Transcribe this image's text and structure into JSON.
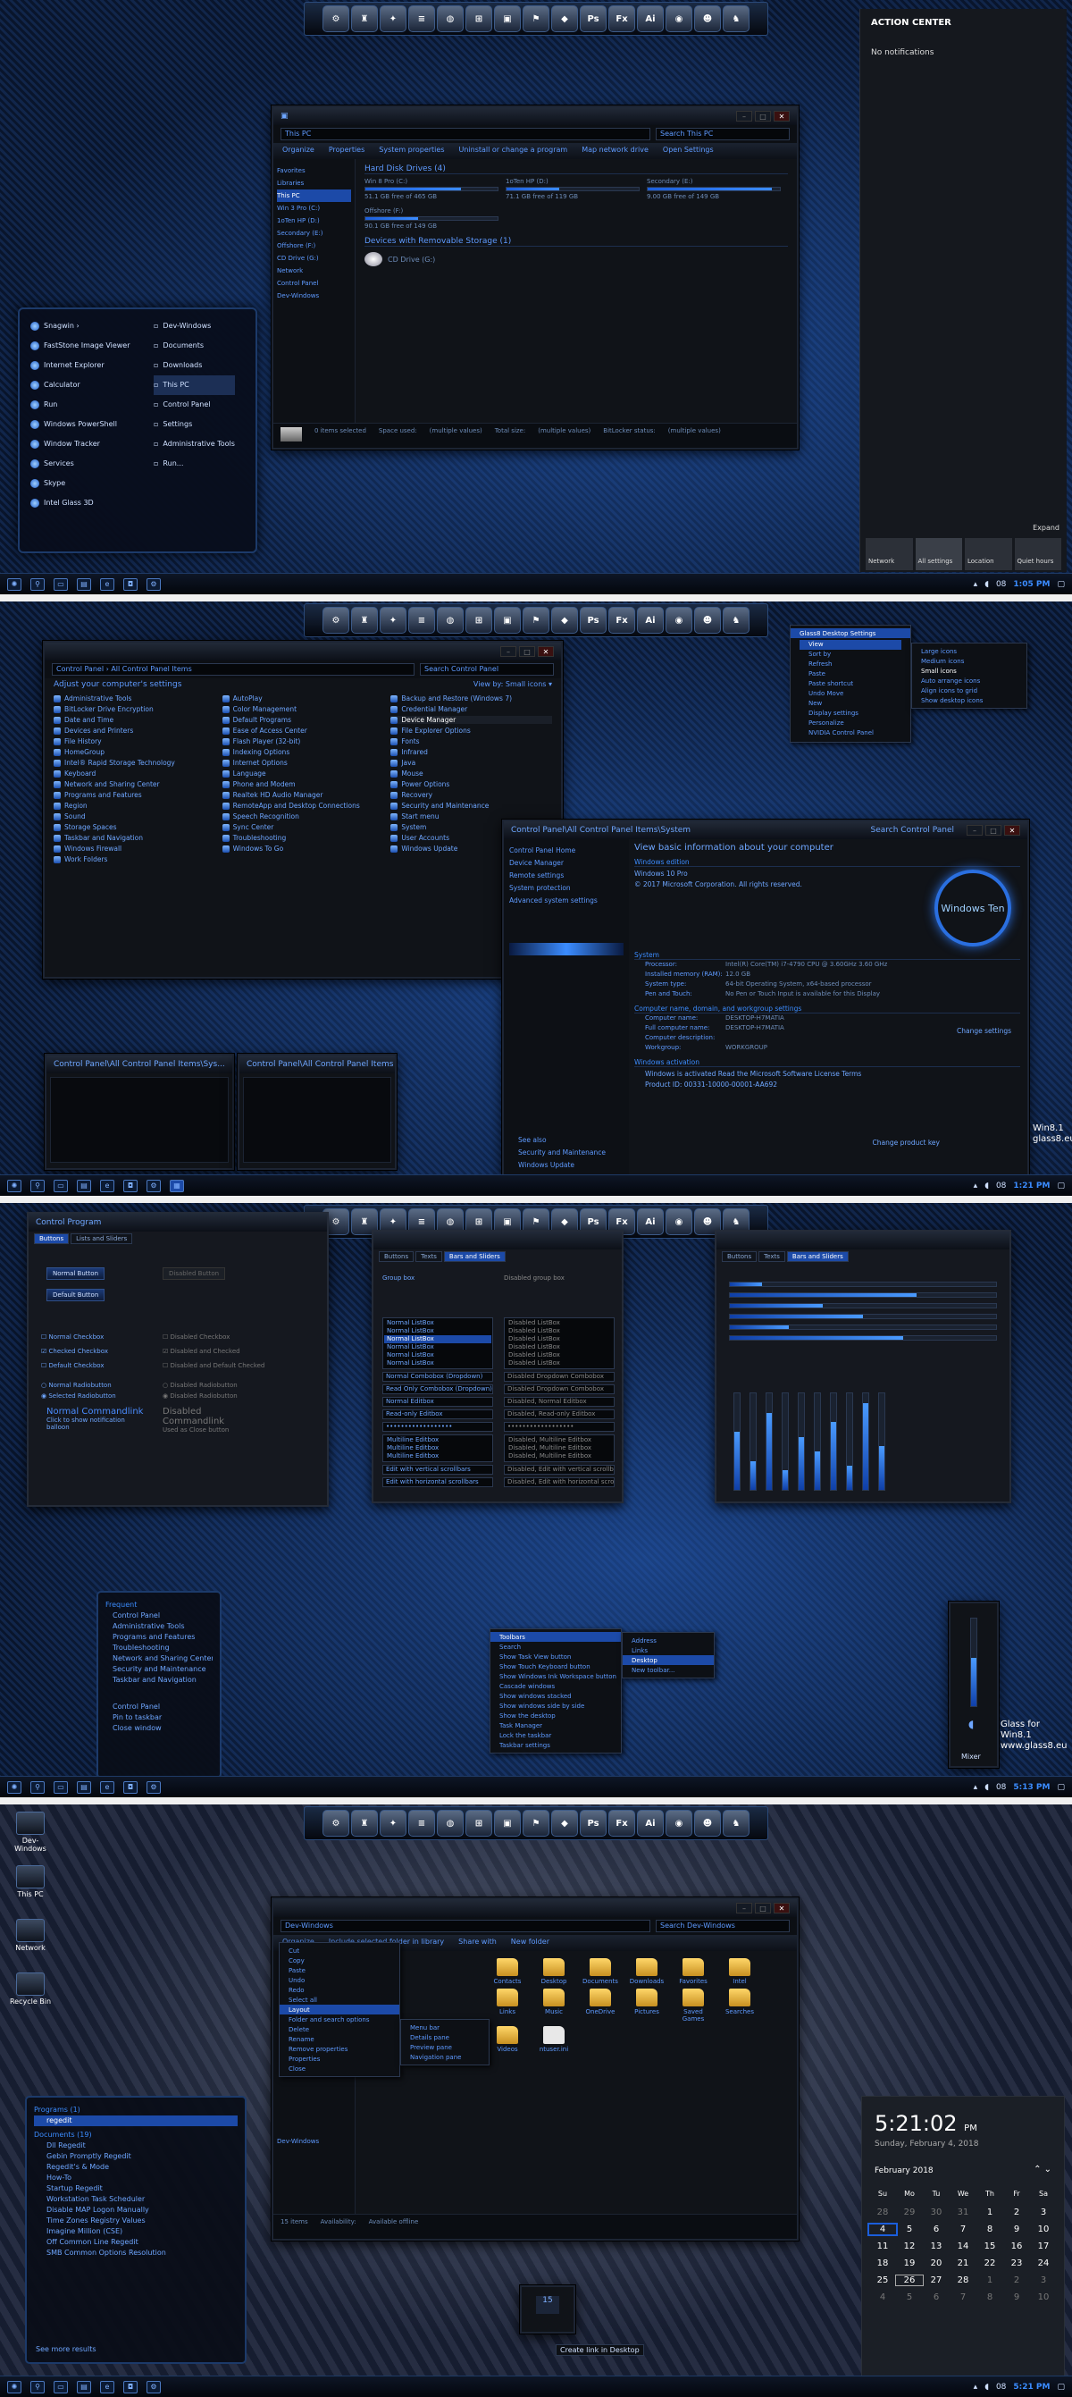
{
  "dock": {
    "icons": [
      "⚙",
      "♜",
      "✦",
      "≡",
      "◍",
      "⊞",
      "▣",
      "⚑",
      "◆",
      "Ps",
      "Fx",
      "Ai",
      "◉",
      "☻",
      "♞"
    ]
  },
  "panel1": {
    "explorer": {
      "address": "This PC",
      "search": "Search This PC",
      "commands": [
        "Organize",
        "Properties",
        "System properties",
        "Uninstall or change a program",
        "Map network drive",
        "Open Settings"
      ],
      "nav": [
        "Favorites",
        "Libraries",
        "This PC",
        "Win 3 Pro (C:)",
        "1oTen HP (D:)",
        "Secondary (E:)",
        "Offshore (F:)",
        "CD Drive (G:)",
        "Network",
        "Control Panel",
        "Dev-Windows"
      ],
      "group1": "Hard Disk Drives (4)",
      "drives": [
        {
          "name": "Win 8 Pro (C:)",
          "free": "51.1 GB free of 465 GB",
          "pct": 0.72
        },
        {
          "name": "1oTen HP (D:)",
          "free": "71.1 GB free of 119 GB",
          "pct": 0.4
        },
        {
          "name": "Secondary (E:)",
          "free": "9.00 GB free of 149 GB",
          "pct": 0.94
        },
        {
          "name": "Offshore (F:)",
          "free": "90.1 GB free of 149 GB",
          "pct": 0.4
        }
      ],
      "group2": "Devices with Removable Storage (1)",
      "removable": "CD Drive (G:)",
      "status": [
        "0 items selected",
        "Space used:",
        "(multiple values)",
        "Total size:",
        "(multiple values)",
        "BitLocker status:",
        "(multiple values)"
      ],
      "status2": [
        "Space free:",
        "(multiple values)",
        "File system:",
        "NTFS"
      ]
    },
    "startmenu": {
      "left": [
        "Snagwin ›",
        "FastStone Image Viewer",
        "Internet Explorer",
        "Calculator",
        "Run",
        "Windows PowerShell",
        "Window Tracker",
        "Services",
        "Skype",
        "Intel Glass 3D"
      ],
      "right": [
        "Dev-Windows",
        "Documents",
        "Downloads",
        "This PC",
        "Control Panel",
        "Settings",
        "Administrative Tools",
        "Run..."
      ]
    },
    "action_center": {
      "title": "ACTION CENTER",
      "empty": "No notifications",
      "expand": "Expand",
      "tiles": [
        {
          "label": "Network",
          "on": false
        },
        {
          "label": "All settings",
          "on": true
        },
        {
          "label": "Location",
          "on": false
        },
        {
          "label": "Quiet hours",
          "on": false
        }
      ]
    },
    "clock": "1:05 PM"
  },
  "panel2": {
    "cp": {
      "address": "Control Panel  ›  All Control Panel Items",
      "search": "Search Control Panel",
      "heading": "Adjust your computer's settings",
      "viewby": "View by:  Small icons ▾",
      "items": [
        "Administrative Tools",
        "AutoPlay",
        "Backup and Restore (Windows 7)",
        "BitLocker Drive Encryption",
        "Color Management",
        "Credential Manager",
        "Date and Time",
        "Default Programs",
        "Device Manager",
        "Devices and Printers",
        "Ease of Access Center",
        "File Explorer Options",
        "File History",
        "Flash Player (32-bit)",
        "Fonts",
        "HomeGroup",
        "Indexing Options",
        "Infrared",
        "Intel® Rapid Storage Technology",
        "Internet Options",
        "Java",
        "Keyboard",
        "Language",
        "Mouse",
        "Network and Sharing Center",
        "Phone and Modem",
        "Power Options",
        "Programs and Features",
        "Realtek HD Audio Manager",
        "Recovery",
        "Region",
        "RemoteApp and Desktop Connections",
        "Security and Maintenance",
        "Sound",
        "Speech Recognition",
        "Start menu",
        "Storage Spaces",
        "Sync Center",
        "System",
        "Taskbar and Navigation",
        "Troubleshooting",
        "User Accounts",
        "Windows Firewall",
        "Windows To Go",
        "Windows Update",
        "Work Folders",
        "",
        ""
      ]
    },
    "sys": {
      "address": "Control Panel\\All Control Panel Items\\System",
      "search": "Search Control Panel",
      "links": [
        "Control Panel Home",
        "Device Manager",
        "Remote settings",
        "System protection",
        "Advanced system settings"
      ],
      "seealso": [
        "See also",
        "Security and Maintenance",
        "Windows Update"
      ],
      "heading": "View basic information about your computer",
      "edition_h": "Windows edition",
      "edition": "Windows 10 Pro",
      "copyright": "© 2017 Microsoft Corporation. All rights reserved.",
      "logo": "Windows Ten",
      "system_h": "System",
      "rows": [
        {
          "k": "Processor:",
          "v": "Intel(R) Core(TM) i7-4790 CPU @ 3.60GHz   3.60 GHz"
        },
        {
          "k": "Installed memory (RAM):",
          "v": "12.0 GB"
        },
        {
          "k": "System type:",
          "v": "64-bit Operating System, x64-based processor"
        },
        {
          "k": "Pen and Touch:",
          "v": "No Pen or Touch Input is available for this Display"
        }
      ],
      "name_h": "Computer name, domain, and workgroup settings",
      "name_rows": [
        {
          "k": "Computer name:",
          "v": "DESKTOP-H7MATIA"
        },
        {
          "k": "Full computer name:",
          "v": "DESKTOP-H7MATIA"
        },
        {
          "k": "Computer description:",
          "v": ""
        },
        {
          "k": "Workgroup:",
          "v": "WORKGROUP"
        }
      ],
      "change": "Change settings",
      "act_h": "Windows activation",
      "act": "Windows is activated   Read the Microsoft Software License Terms",
      "pid": "Product ID: 00331-10000-00001-AA692",
      "changekey": "Change product key"
    },
    "ctx": {
      "items": [
        "View",
        "Sort by",
        "Refresh",
        "Paste",
        "Paste shortcut",
        "Undo Move",
        "New",
        "Display settings",
        "Personalize",
        "NVIDIA Control Panel"
      ],
      "sub": [
        "Large icons",
        "Medium icons",
        "Small icons",
        "Auto arrange icons",
        "Align icons to grid",
        "Show desktop icons"
      ],
      "title": "Glass8 Desktop Settings"
    },
    "thumbs": [
      "Control Panel\\All Control Panel Items\\Sys...",
      "Control Panel\\All Control Panel Items"
    ],
    "watermark": [
      "Win8.1",
      "glass8.eu"
    ],
    "clock": "1:21 PM"
  },
  "panel3": {
    "win1": {
      "title": "Control Program",
      "tabs": [
        "Buttons",
        "Lists and Sliders"
      ],
      "normal_button": "Normal Button",
      "default_button": "Default Button",
      "disabled_button": "Disabled Button",
      "checks": [
        "Normal Checkbox",
        "Checked Checkbox",
        "Default Checkbox"
      ],
      "dchecks": [
        "Disabled Checkbox",
        "Disabled and Checked",
        "Disabled and Default Checked"
      ],
      "radios": [
        "Normal Radiobutton",
        "Selected Radiobutton"
      ],
      "dradios": [
        "Disabled Radiobutton",
        "Disabled Radiobutton"
      ],
      "cmd": "Normal Commandlink",
      "cmd_sub": "Click to show notification balloon",
      "dcmd": "Disabled Commandlink",
      "dcmd_sub": "Used as Close button"
    },
    "win2": {
      "tabs": [
        "Buttons",
        "Texts",
        "Bars and Sliders"
      ],
      "group_a": "Group box",
      "group_b": "Disabled group box",
      "list": [
        "Normal ListBox",
        "Normal ListBox",
        "Normal ListBox",
        "Normal ListBox",
        "Normal ListBox",
        "Normal ListBox"
      ],
      "dlist": [
        "Disabled ListBox",
        "Disabled ListBox",
        "Disabled ListBox",
        "Disabled ListBox",
        "Disabled ListBox",
        "Disabled ListBox"
      ],
      "combos": [
        "Normal Combobox (Dropdown)",
        "Disabled Dropdown Combobox",
        "Read Only Combobox (Dropdown)",
        "Disabled Dropdown Combobox"
      ],
      "edits": [
        "Normal Editbox",
        "Disabled, Normal Editbox",
        "Read-only Editbox",
        "Disabled, Read-only Editbox"
      ],
      "password": "••••••••••••••••••",
      "multi": [
        "Multiline Editbox",
        "Multiline Editbox",
        "Multiline Editbox"
      ],
      "dmulti": [
        "Disabled, Multiline Editbox",
        "Disabled, Multiline Editbox",
        "Disabled, Multiline Editbox"
      ],
      "vscroll": "Edit with vertical scrollbars",
      "hscroll": "Edit with horizontal scrollbars",
      "dvscroll": "Disabled, Edit with vertical scrollbars",
      "dhscroll": "Disabled, Edit with horizontal scrollbars"
    },
    "win3": {
      "tabs": [
        "Buttons",
        "Texts",
        "Bars and Sliders"
      ],
      "hbars": [
        0.12,
        0.7,
        0.35,
        0.5,
        0.22,
        0.65
      ],
      "vbars": [
        0.6,
        0.3,
        0.8,
        0.2,
        0.55,
        0.4,
        0.7,
        0.25,
        0.9,
        0.45
      ]
    },
    "ctx_tb": {
      "items": [
        "Toolbars",
        "Search",
        "Show Task View button",
        "Show Touch Keyboard button",
        "Show Windows Ink Workspace button",
        "Cascade windows",
        "Show windows stacked",
        "Show windows side by side",
        "Show the desktop",
        "Task Manager",
        "Lock the taskbar",
        "Taskbar settings"
      ],
      "sub": [
        "Address",
        "Links",
        "Desktop",
        "New toolbar..."
      ]
    },
    "jumplist": {
      "title": "Frequent",
      "items": [
        "Control Panel",
        "Administrative Tools",
        "Programs and Features",
        "Troubleshooting",
        "Network and Sharing Center",
        "Security and Maintenance",
        "Taskbar and Navigation"
      ],
      "actions": [
        "Control Panel",
        "Pin to taskbar",
        "Close window"
      ]
    },
    "mixer": {
      "level": 0.55,
      "label": "Mixer"
    },
    "watermark": [
      "Glass for Win8.1",
      "www.glass8.eu"
    ],
    "clock": "5:13 PM"
  },
  "panel4": {
    "desktop": [
      "Dev-Windows",
      "This PC",
      "Network",
      "Recycle Bin"
    ],
    "explorer": {
      "address": "Dev-Windows",
      "search": "Search Dev-Windows",
      "commands": [
        "Organize",
        "Include selected folder in library",
        "Share with",
        "New folder"
      ],
      "organize": [
        "Cut",
        "Copy",
        "Paste",
        "Undo",
        "Redo",
        "Select all",
        "Layout",
        "Folder and search options",
        "Delete",
        "Rename",
        "Remove properties",
        "Properties",
        "Close"
      ],
      "layout_sub": [
        "Menu bar",
        "Details pane",
        "Preview pane",
        "Navigation pane"
      ],
      "folders": [
        "Contacts",
        "Desktop",
        "Documents",
        "Downloads",
        "Favorites",
        "Intel",
        "Links",
        "Music",
        "OneDrive",
        "Pictures",
        "Saved Games",
        "Searches",
        "Videos",
        "ntuser.ini"
      ],
      "nav": "Dev-Windows",
      "status": [
        "15 items",
        "Availability:",
        "Available offline"
      ]
    },
    "search_panel": {
      "programs_h": "Programs (1)",
      "programs": [
        "regedit"
      ],
      "docs_h": "Documents (19)",
      "docs": [
        "Dll Regedit",
        "Gebin Promptly Regedit",
        "Regedit's & Mode",
        "How-To",
        "Startup Regedit",
        "Workstation Task Scheduler",
        "Disable MAP Logon Manually",
        "Time Zones Registry Values",
        "Imagine Million (CSE)",
        "Off Common Line Regedit",
        "SMB Common Options Resolution"
      ],
      "see_more": "See more results"
    },
    "time": "5:21:02",
    "ampm": "PM",
    "date": "Sunday, February 4, 2018",
    "cal_month": "February 2018",
    "cal_head": [
      "Su",
      "Mo",
      "Tu",
      "We",
      "Th",
      "Fr",
      "Sa"
    ],
    "cal_days": [
      "28",
      "29",
      "30",
      "31",
      "1",
      "2",
      "3",
      "4",
      "5",
      "6",
      "7",
      "8",
      "9",
      "10",
      "11",
      "12",
      "13",
      "14",
      "15",
      "16",
      "17",
      "18",
      "19",
      "20",
      "21",
      "22",
      "23",
      "24",
      "25",
      "26",
      "27",
      "28",
      "1",
      "2",
      "3",
      "4",
      "5",
      "6",
      "7",
      "8",
      "9",
      "10"
    ],
    "tooltip": "Create link in Desktop",
    "clock": "5:21 PM"
  },
  "tray": {
    "lang": "EN",
    "date1": "08"
  }
}
